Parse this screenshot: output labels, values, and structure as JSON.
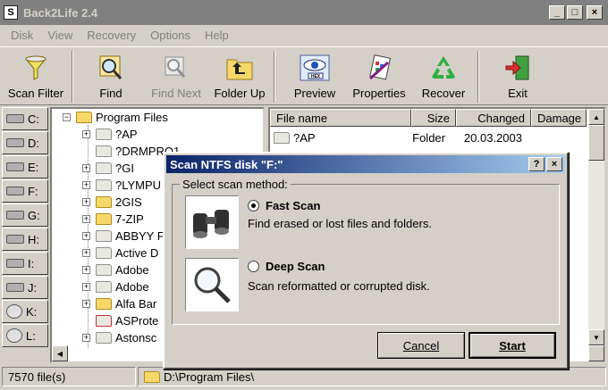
{
  "window": {
    "title": "Back2Life 2.4",
    "minimize": "_",
    "maximize": "□",
    "close": "×"
  },
  "menu": [
    "Disk",
    "View",
    "Recovery",
    "Options",
    "Help"
  ],
  "toolbar": {
    "scan_filter": "Scan Filter",
    "find": "Find",
    "find_next": "Find Next",
    "folder_up": "Folder Up",
    "preview": "Preview",
    "properties": "Properties",
    "recover": "Recover",
    "exit": "Exit",
    "preview_badge": "HEX"
  },
  "drives": [
    "C:",
    "D:",
    "E:",
    "F:",
    "G:",
    "H:",
    "I:",
    "J:",
    "K:",
    "L:"
  ],
  "tree": {
    "root": "Program Files",
    "items": [
      "?AP",
      "?DRMPRO1",
      "?GI",
      "?LYMPU",
      "2GIS",
      "7-ZIP",
      "ABBYY F",
      "Active D",
      "Adobe",
      "Adobe",
      "Alfa Bar",
      "ASProte",
      "Astonsc"
    ]
  },
  "filelist": {
    "columns": [
      "File name",
      "Size",
      "Changed",
      "Damage"
    ],
    "rows": [
      {
        "name": "?AP",
        "size": "Folder",
        "changed": "20.03.2003",
        "damage": ""
      }
    ]
  },
  "status": {
    "count": "7570  file(s)",
    "path": "D:\\Program Files\\"
  },
  "dialog": {
    "title": "Scan NTFS disk \"F:\"",
    "help": "?",
    "close": "×",
    "group_label": "Select scan method:",
    "fast_label": "Fast Scan",
    "fast_desc": "Find erased or lost files and folders.",
    "deep_label": "Deep Scan",
    "deep_desc": "Scan reformatted or corrupted disk.",
    "cancel": "Cancel",
    "start": "Start",
    "selected": "fast"
  }
}
